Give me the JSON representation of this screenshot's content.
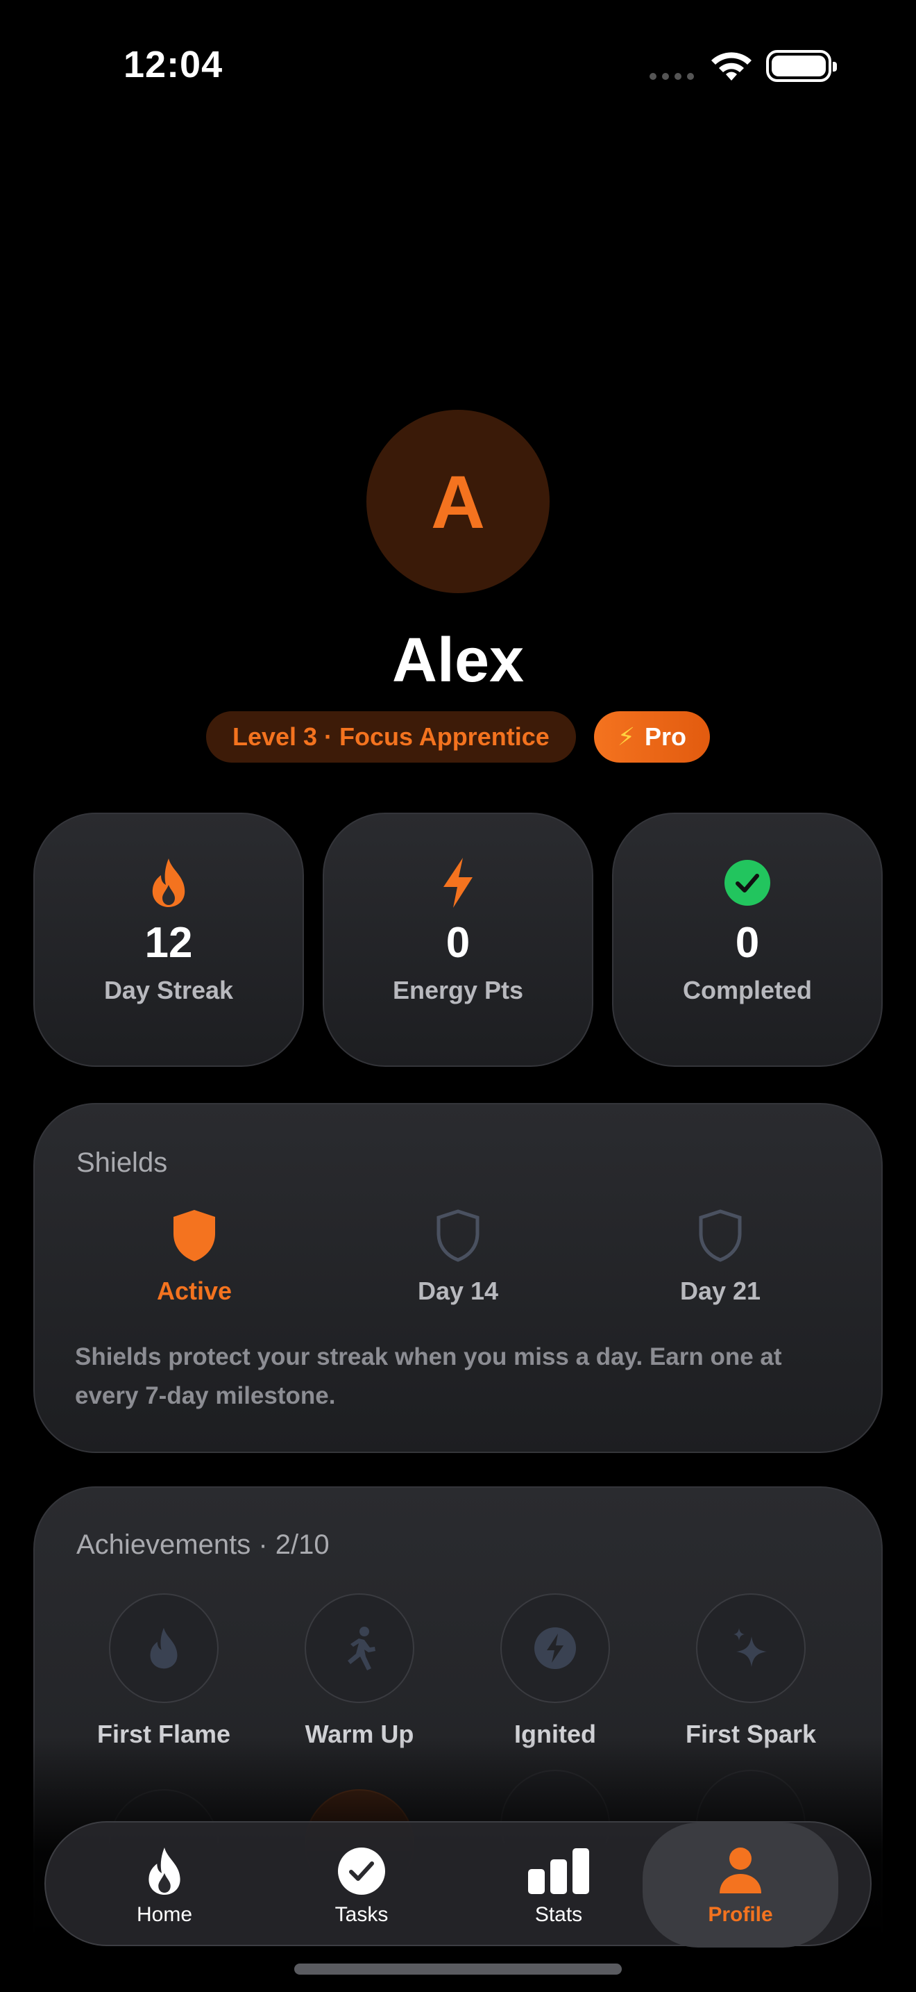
{
  "status_bar": {
    "time": "12:04"
  },
  "profile": {
    "avatar_initial": "A",
    "name": "Alex",
    "level_badge": "Level 3 · Focus Apprentice",
    "pro_badge": "Pro",
    "pro_icon": "⚡"
  },
  "stats": [
    {
      "icon": "flame-icon",
      "value": "12",
      "label": "Day Streak"
    },
    {
      "icon": "bolt-icon",
      "value": "0",
      "label": "Energy Pts"
    },
    {
      "icon": "check-circle-icon",
      "value": "0",
      "label": "Completed"
    }
  ],
  "shields": {
    "title": "Shields",
    "items": [
      {
        "label": "Active",
        "state": "active"
      },
      {
        "label": "Day 14",
        "state": "locked"
      },
      {
        "label": "Day 21",
        "state": "locked"
      }
    ],
    "description": "Shields protect your streak when you miss a day. Earn one at every 7-day milestone."
  },
  "achievements": {
    "title": "Achievements · 2/10",
    "items": [
      {
        "label": "First Flame",
        "icon": "flame-icon"
      },
      {
        "label": "Warm Up",
        "icon": "runner-icon"
      },
      {
        "label": "Ignited",
        "icon": "bolt-circle-icon"
      },
      {
        "label": "First Spark",
        "icon": "sparkles-icon"
      }
    ]
  },
  "tabbar": {
    "items": [
      {
        "label": "Home",
        "icon": "flame-icon"
      },
      {
        "label": "Tasks",
        "icon": "check-circle-icon"
      },
      {
        "label": "Stats",
        "icon": "bar-chart-icon"
      },
      {
        "label": "Profile",
        "icon": "person-icon",
        "selected": true
      }
    ]
  },
  "colors": {
    "accent": "#f4731f",
    "success": "#22c55e",
    "background": "#000000",
    "card": "#232428"
  }
}
